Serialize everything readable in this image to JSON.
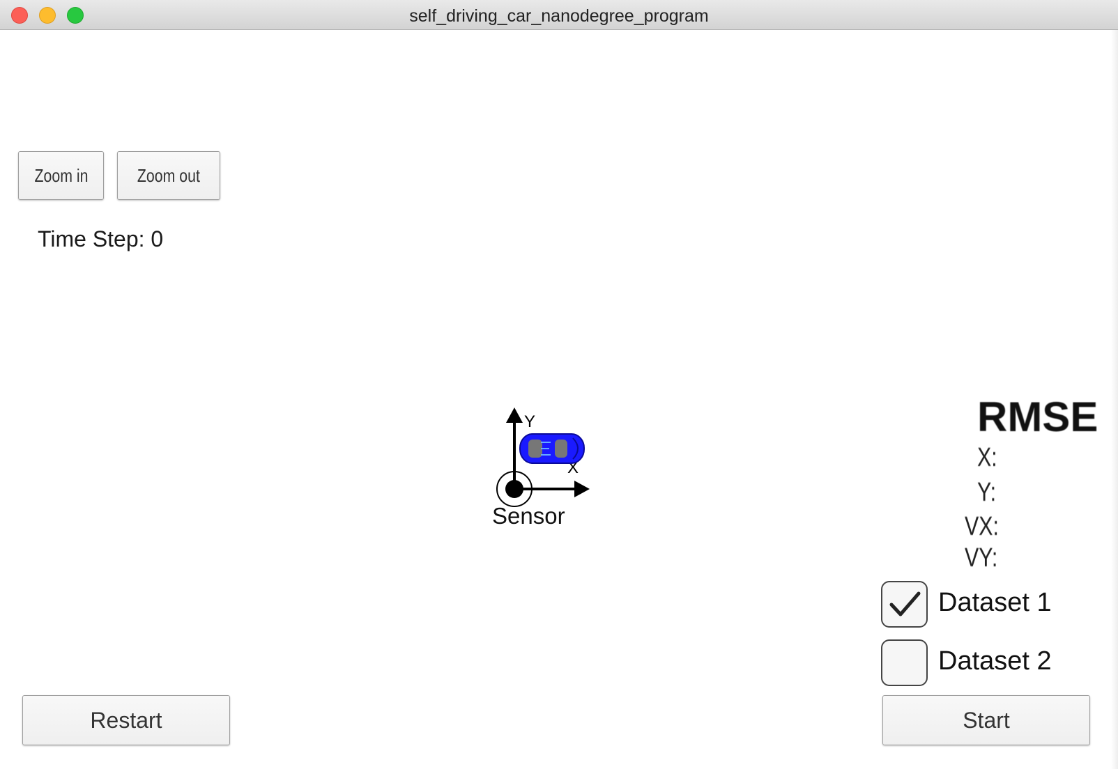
{
  "window": {
    "title": "self_driving_car_nanodegree_program"
  },
  "toolbar": {
    "zoom_in_label": "Zoom in",
    "zoom_out_label": "Zoom out"
  },
  "status": {
    "time_step_text": "Time Step: 0"
  },
  "scene": {
    "sensor_label": "Sensor",
    "axis_y_label": "Y",
    "axis_x_label": "X",
    "car_color": "#1a1aff"
  },
  "rmse": {
    "title": "RMSE",
    "x_label": "X:",
    "y_label": "Y:",
    "vx_label": "VX:",
    "vy_label": "VY:"
  },
  "datasets": [
    {
      "label": "Dataset 1",
      "checked": true
    },
    {
      "label": "Dataset 2",
      "checked": false
    }
  ],
  "controls": {
    "restart_label": "Restart",
    "start_label": "Start"
  }
}
